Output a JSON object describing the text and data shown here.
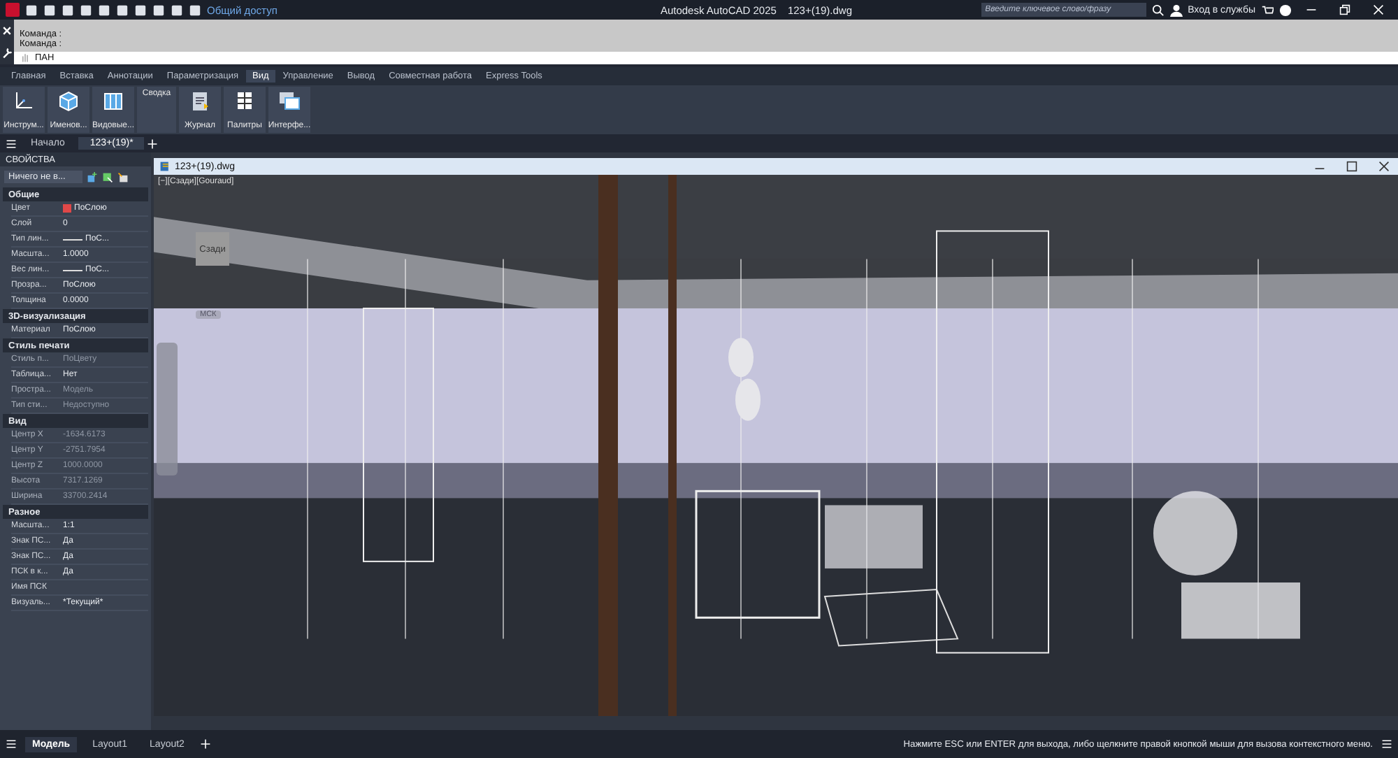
{
  "title_bar": {
    "share": "Общий доступ",
    "title": "Autodesk AutoCAD 2025",
    "file": "123+(19).dwg",
    "search": {
      "placeholder": "Введите ключевое слово/фразу"
    },
    "sign_in": "Вход в службы"
  },
  "command_line": {
    "history": [
      "Команда :",
      "Команда :"
    ],
    "input": "ПАН"
  },
  "ribbon_tabs": [
    {
      "label": "Главная",
      "selected": false
    },
    {
      "label": "Вставка",
      "selected": false
    },
    {
      "label": "Аннотации",
      "selected": false
    },
    {
      "label": "Параметризация",
      "selected": false
    },
    {
      "label": "Вид",
      "selected": true
    },
    {
      "label": "Управление",
      "selected": false
    },
    {
      "label": "Вывод",
      "selected": false
    },
    {
      "label": "Совместная работа",
      "selected": false
    },
    {
      "label": "Express Tools",
      "selected": false
    }
  ],
  "ribbon_buttons": [
    {
      "label": "Инструм...",
      "kind": "ucs"
    },
    {
      "label": "Именов...",
      "kind": "cube"
    },
    {
      "label": "Видовые...",
      "kind": "viewports"
    },
    {
      "label": "Сводка",
      "kind": "text"
    },
    {
      "label": "Журнал",
      "kind": "clipboard"
    },
    {
      "label": "Палитры",
      "kind": "grid"
    },
    {
      "label": "Интерфе...",
      "kind": "windows"
    }
  ],
  "file_tabs": [
    {
      "label": "Начало",
      "selected": false
    },
    {
      "label": "123+(19)*",
      "selected": true
    }
  ],
  "properties": {
    "title": "СВОЙСТВА",
    "selection": "Ничего не в...",
    "sections": [
      {
        "title": "Общие",
        "rows": [
          {
            "label": "Цвет",
            "value": "ПоСлою",
            "kind": "color",
            "color": "#e04848",
            "disabled": false
          },
          {
            "label": "Слой",
            "value": "0",
            "kind": "text",
            "disabled": false
          },
          {
            "label": "Тип лин...",
            "value": "ПоС...",
            "kind": "linetype",
            "disabled": false
          },
          {
            "label": "Масшта...",
            "value": "1.0000",
            "kind": "text",
            "disabled": false
          },
          {
            "label": "Вес лин...",
            "value": "ПоС...",
            "kind": "linetype",
            "disabled": false
          },
          {
            "label": "Прозра...",
            "value": "ПоСлою",
            "kind": "text",
            "disabled": false
          },
          {
            "label": "Толщина",
            "value": "0.0000",
            "kind": "text",
            "disabled": false
          }
        ]
      },
      {
        "title": "3D-визуализация",
        "rows": [
          {
            "label": "Материал",
            "value": "ПоСлою",
            "kind": "text",
            "disabled": false
          }
        ]
      },
      {
        "title": "Стиль печати",
        "rows": [
          {
            "label": "Стиль п...",
            "value": "ПоЦвету",
            "kind": "text",
            "disabled": true
          },
          {
            "label": "Таблица...",
            "value": "Нет",
            "kind": "text",
            "disabled": false
          },
          {
            "label": "Простра...",
            "value": "Модель",
            "kind": "text",
            "disabled": true
          },
          {
            "label": "Тип сти...",
            "value": "Недоступно",
            "kind": "text",
            "disabled": true
          }
        ]
      },
      {
        "title": "Вид",
        "rows": [
          {
            "label": "Центр X",
            "value": "-1634.6173",
            "kind": "text",
            "disabled": true
          },
          {
            "label": "Центр Y",
            "value": "-2751.7954",
            "kind": "text",
            "disabled": true
          },
          {
            "label": "Центр Z",
            "value": "1000.0000",
            "kind": "text",
            "disabled": true
          },
          {
            "label": "Высота",
            "value": "7317.1269",
            "kind": "text",
            "disabled": true
          },
          {
            "label": "Ширина",
            "value": "33700.2414",
            "kind": "text",
            "disabled": true
          }
        ]
      },
      {
        "title": "Разное",
        "rows": [
          {
            "label": "Масшта...",
            "value": "1:1",
            "kind": "text",
            "disabled": false
          },
          {
            "label": "Знак ПС...",
            "value": "Да",
            "kind": "text",
            "disabled": false
          },
          {
            "label": "Знак ПС...",
            "value": "Да",
            "kind": "text",
            "disabled": false
          },
          {
            "label": "ПСК в к...",
            "value": "Да",
            "kind": "text",
            "disabled": false
          },
          {
            "label": "Имя ПСК"
          },
          {
            "label": "Визуаль...",
            "value": "*Текущий*",
            "kind": "text",
            "disabled": false
          }
        ]
      }
    ]
  },
  "drawing_window": {
    "title": "123+(19).dwg",
    "viewport_label": "[−][Сзади][Gouraud]",
    "view_cube": "Сзади",
    "compass": "МСК"
  },
  "layout_tabs": [
    {
      "label": "Модель",
      "selected": true
    },
    {
      "label": "Layout1",
      "selected": false
    },
    {
      "label": "Layout2",
      "selected": false
    }
  ],
  "status_message": "Нажмите ESC или ENTER для выхода, либо щелкните правой кнопкой мыши для вызова контекстного меню."
}
